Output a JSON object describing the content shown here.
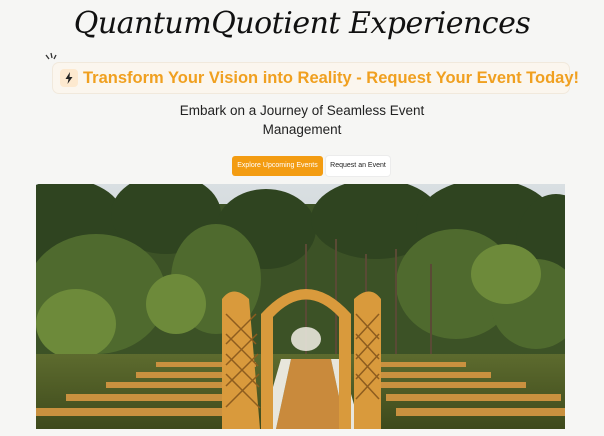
{
  "brand": {
    "logo_text": "QuantumQuotient Experiences"
  },
  "banner": {
    "icon": "lightning-icon",
    "text": "Transform Your Vision into Reality - Request Your Event Today!",
    "accent_color": "#f0a020"
  },
  "hero_copy": {
    "subtitle_line1": "Embark on a Journey of Seamless Event",
    "subtitle_line2": "Management"
  },
  "actions": {
    "primary_label": "Explore Upcoming Events",
    "secondary_label": "Request an Event",
    "primary_color": "#f39c12"
  },
  "hero_image": {
    "subject": "outdoor wedding ceremony with wooden arches and benches"
  }
}
